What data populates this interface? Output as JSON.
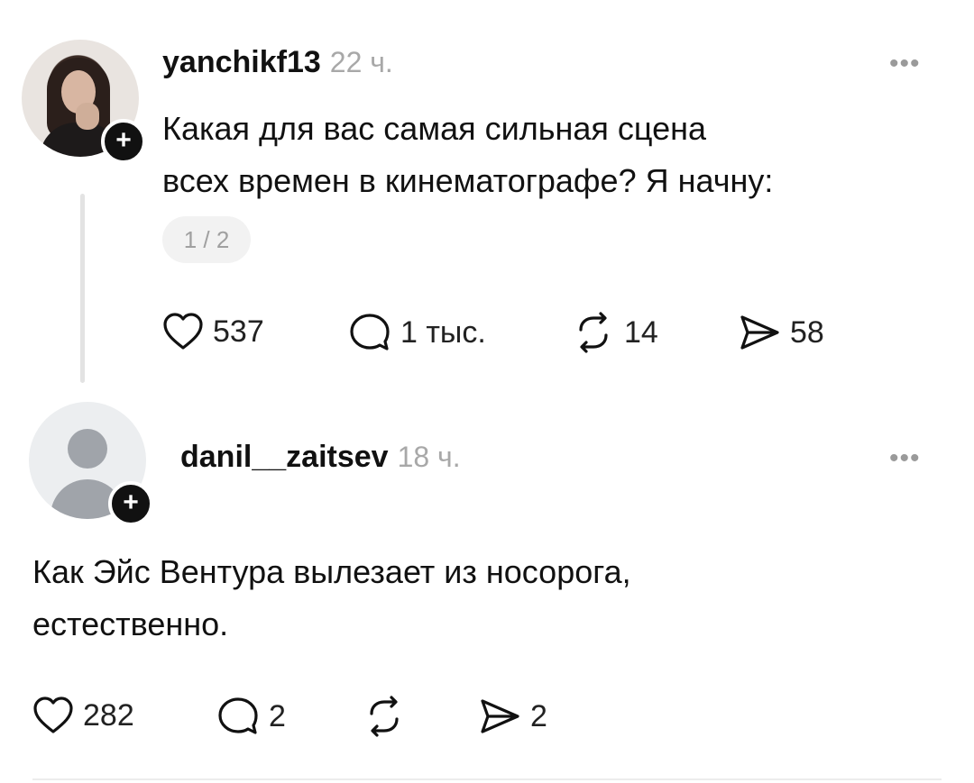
{
  "post": {
    "username": "yanchikf13",
    "time": "22 ч.",
    "text_line1": "Какая для вас самая сильная сцена",
    "text_line2": "всех времен в кинематографе? Я начну:",
    "page_indicator": "1 / 2",
    "likes": "537",
    "replies": "1 тыс.",
    "reposts": "14",
    "shares": "58"
  },
  "reply": {
    "username": "danil__zaitsev",
    "time": "18 ч.",
    "text_line1": "Как Эйс Вентура вылезает из носорога,",
    "text_line2": "естественно.",
    "likes": "282",
    "replies": "2",
    "shares": "2"
  },
  "icons": {
    "more": "more-horizontal-icon",
    "like": "heart-icon",
    "reply": "speech-bubble-icon",
    "repost": "repost-icon",
    "share": "send-icon",
    "follow": "plus-icon"
  }
}
